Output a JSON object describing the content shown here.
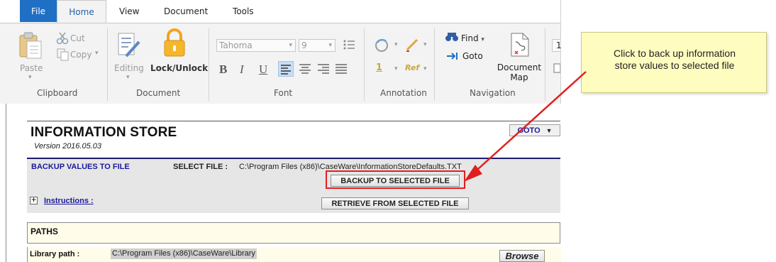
{
  "ribbon": {
    "tabs": [
      "File",
      "Home",
      "View",
      "Document",
      "Tools"
    ],
    "clipboard": {
      "paste": "Paste",
      "cut": "Cut",
      "copy": "Copy",
      "label": "Clipboard"
    },
    "document": {
      "editing": "Editing",
      "lock": "Lock/Unlock",
      "label": "Document"
    },
    "font": {
      "family": "Tahoma",
      "size": "9",
      "bold": "B",
      "italic": "I",
      "underline": "U",
      "label": "Font"
    },
    "annotation": {
      "label": "Annotation",
      "ref": "Ref",
      "num": "1"
    },
    "navigation": {
      "find": "Find",
      "goto": "Goto",
      "doc_map_line1": "Document",
      "doc_map_line2": "Map",
      "label": "Navigation"
    },
    "partial_field": "1"
  },
  "doc": {
    "title": "INFORMATION STORE",
    "version": "Version 2016.05.03",
    "goto": "GOTO",
    "backup": {
      "section": "BACKUP VALUES TO FILE",
      "select_label": "SELECT FILE :",
      "select_path": "C:\\Program Files (x86)\\CaseWare\\InformationStoreDefaults.TXT",
      "backup_button": "BACKUP TO SELECTED FILE",
      "retrieve_button": "RETRIEVE FROM SELECTED FILE",
      "expand": "+",
      "instructions": "Instructions :"
    },
    "paths": {
      "heading": "PATHS",
      "library_label": "Library path :",
      "library_value": "C:\\Program Files (x86)\\CaseWare\\Library",
      "browse": "Browse"
    }
  },
  "callout": {
    "line1": "Click to back up information",
    "line2": "store values to selected file"
  },
  "colors": {
    "accent": "#1f6fc5",
    "arrow": "#e02020",
    "highlight": "#e02020",
    "section_text": "#1a1a9c",
    "callout_bg": "#fffcc0"
  }
}
